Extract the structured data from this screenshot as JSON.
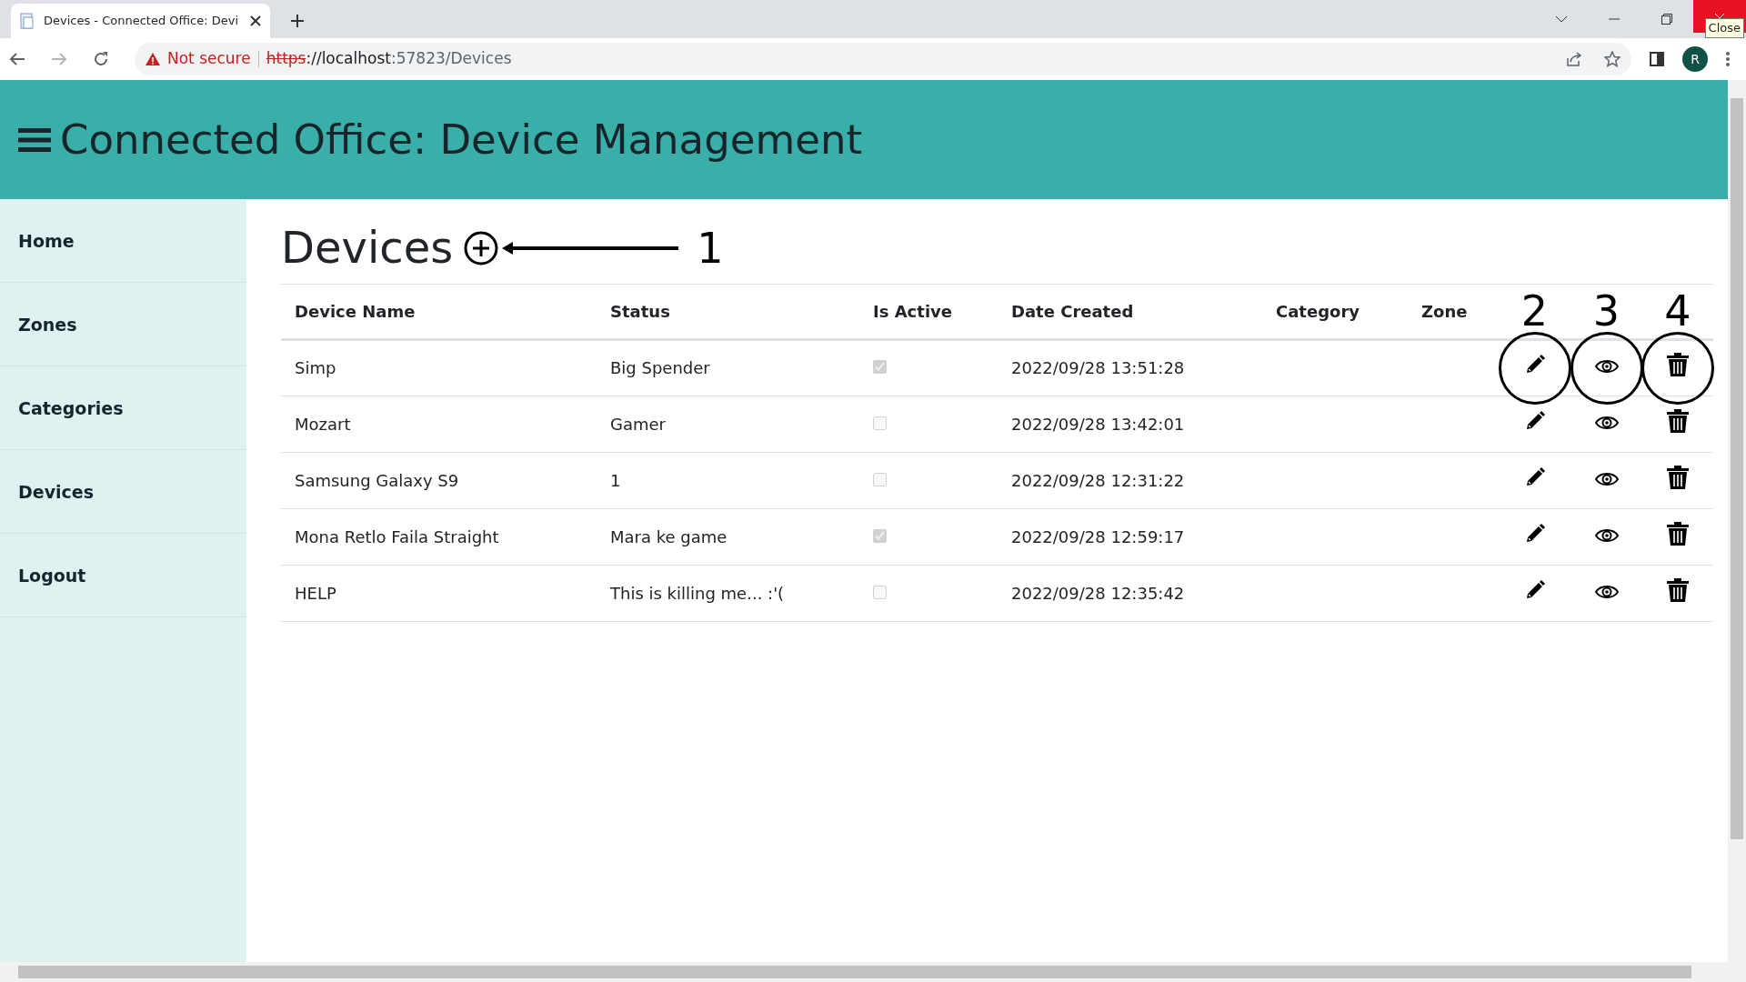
{
  "browser": {
    "tab_title": "Devices - Connected Office: Devi",
    "warning": "Not secure",
    "scheme": "https",
    "host": "://localhost",
    "path": ":57823/Devices",
    "profile_initial": "R",
    "tooltip": "Close"
  },
  "header": {
    "title": "Connected Office: Device Management"
  },
  "sidebar": {
    "items": [
      {
        "label": "Home"
      },
      {
        "label": "Zones"
      },
      {
        "label": "Categories"
      },
      {
        "label": "Devices"
      },
      {
        "label": "Logout"
      }
    ]
  },
  "page": {
    "heading": "Devices"
  },
  "annotations": {
    "add": "1",
    "edit": "2",
    "view": "3",
    "delete": "4"
  },
  "table": {
    "columns": [
      "Device Name",
      "Status",
      "Is Active",
      "Date Created",
      "Category",
      "Zone"
    ],
    "rows": [
      {
        "name": "Simp",
        "status": "Big Spender",
        "active": true,
        "disabled": true,
        "date": "2022/09/28 13:51:28"
      },
      {
        "name": "Mozart",
        "status": "Gamer",
        "active": false,
        "disabled": true,
        "date": "2022/09/28 13:42:01"
      },
      {
        "name": "Samsung Galaxy S9",
        "status": "1",
        "active": false,
        "disabled": true,
        "date": "2022/09/28 12:31:22"
      },
      {
        "name": "Mona Retlo Faila Straight",
        "status": "Mara ke game",
        "active": true,
        "disabled": true,
        "date": "2022/09/28 12:59:17"
      },
      {
        "name": "HELP",
        "status": "This is killing me... :'(",
        "active": false,
        "disabled": true,
        "date": "2022/09/28 12:35:42"
      }
    ]
  }
}
